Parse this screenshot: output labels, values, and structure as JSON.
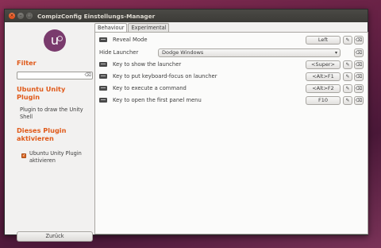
{
  "window": {
    "title": "CompizConfig Einstellungs-Manager",
    "controls": {
      "close": "×",
      "minimize": "–",
      "maximize": "□"
    }
  },
  "sidebar": {
    "logo_letter": "u",
    "filter_heading": "Filter",
    "filter_value": "",
    "filter_clear_icon": "⌫",
    "plugin_heading": "Ubuntu Unity Plugin",
    "plugin_description": "Plugin to draw the Unity Shell",
    "enable_heading": "Dieses Plugin aktivieren",
    "enable_label": "Ubuntu Unity Plugin aktivieren",
    "enable_checked": true,
    "back_label": "Zurück"
  },
  "tabs": [
    {
      "label": "Behaviour",
      "active": true
    },
    {
      "label": "Experimental",
      "active": false
    }
  ],
  "settings": [
    {
      "label": "Reveal Mode",
      "kind": "key",
      "value": "Left"
    },
    {
      "label": "Hide Launcher",
      "kind": "select",
      "value": "Dodge Windows"
    },
    {
      "label": "Key to show the launcher",
      "kind": "key",
      "value": "<Super>"
    },
    {
      "label": "Key to put keyboard-focus on launcher",
      "kind": "key",
      "value": "<Alt>F1"
    },
    {
      "label": "Key to execute a command",
      "kind": "key",
      "value": "<Alt>F2"
    },
    {
      "label": "Key to open the first panel menu",
      "kind": "key",
      "value": "F10"
    }
  ],
  "icons": {
    "edit": "edit-icon",
    "reset": "reset-icon",
    "keyboard": "keyboard-icon"
  },
  "colors": {
    "accent": "#e05a1a",
    "titlebar": "#3c3b37",
    "background": "#f2f1f0"
  }
}
